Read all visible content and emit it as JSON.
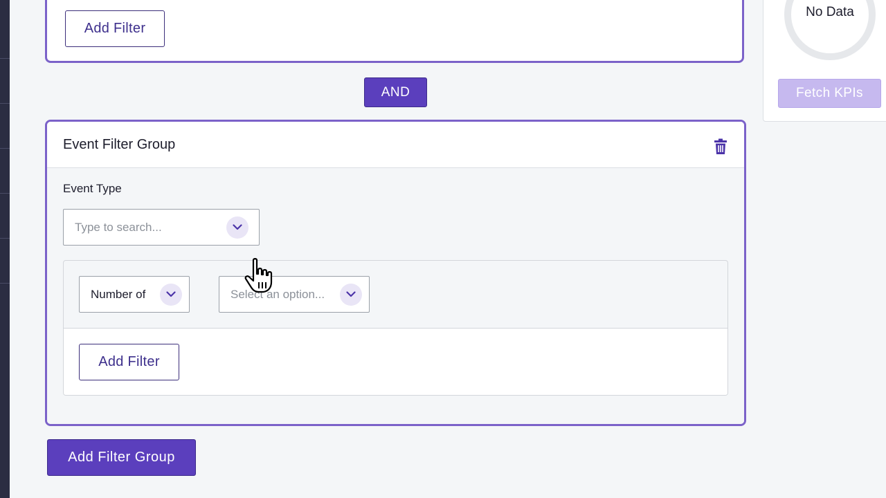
{
  "previous_group": {
    "add_filter_label": "Add Filter"
  },
  "connector": {
    "label": "AND"
  },
  "event_group": {
    "title": "Event Filter Group",
    "event_type_label": "Event Type",
    "event_type_placeholder": "Type to search...",
    "aggregate_value": "Number of",
    "option_placeholder": "Select an option...",
    "add_filter_label": "Add Filter"
  },
  "add_filter_group_label": "Add Filter Group",
  "kpi_panel": {
    "status": "No Data",
    "fetch_label": "Fetch KPIs"
  },
  "colors": {
    "accent": "#5b3fbd",
    "group_border": "#7b62c9",
    "disabled_button": "#c6b9ef"
  }
}
